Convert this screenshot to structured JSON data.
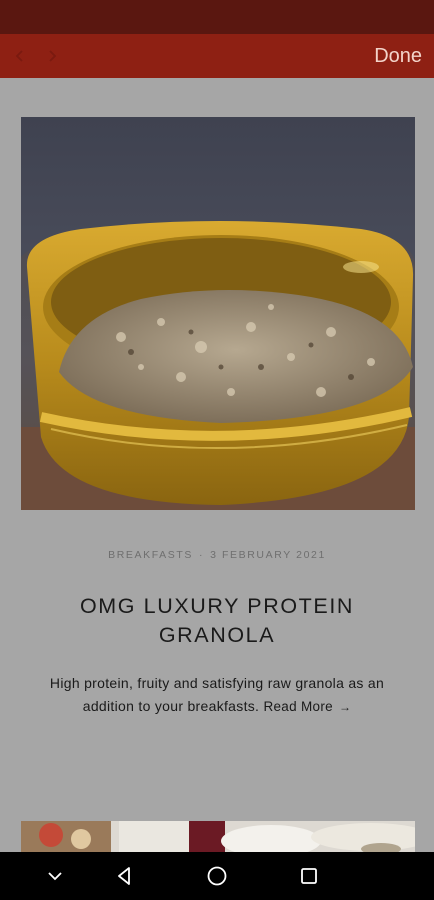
{
  "toolbar": {
    "back_icon": "chevron-left-icon",
    "forward_icon": "chevron-right-icon",
    "done_label": "Done"
  },
  "article": {
    "image_alt": "granola in a yellow glazed bowl",
    "category": "BREAKFASTS",
    "separator": "·",
    "date": "3 FEBRUARY 2021",
    "title": "OMG LUXURY PROTEIN GRANOLA",
    "excerpt": "High protein, fruity and satisfying raw granola as an addition to your breakfasts.",
    "read_more": "Read More",
    "read_more_arrow": "→"
  },
  "system_nav": {
    "icons": [
      "chevron-down-icon",
      "back-triangle-icon",
      "home-circle-icon",
      "recents-square-icon"
    ]
  },
  "colors": {
    "status_bar": "#5a1710",
    "toolbar": "#8e2013",
    "page_background": "#a6a6a6",
    "done_text": "#f3d3c9"
  }
}
